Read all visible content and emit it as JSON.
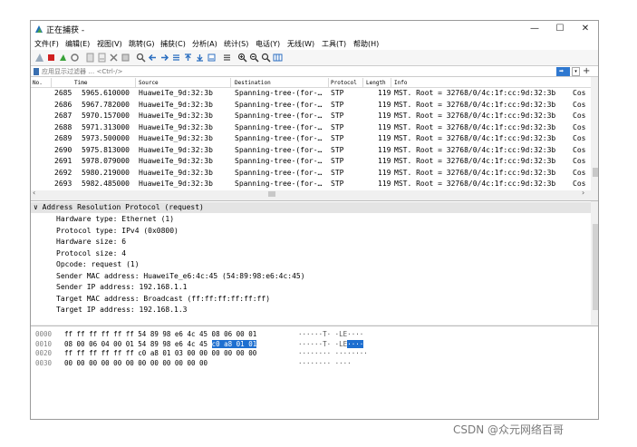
{
  "window": {
    "title": "正在捕获 -",
    "btn_min": "—",
    "btn_max": "☐",
    "btn_close": "✕"
  },
  "menu": [
    "文件(F)",
    "编辑(E)",
    "视图(V)",
    "跳转(G)",
    "捕获(C)",
    "分析(A)",
    "统计(S)",
    "电话(Y)",
    "无线(W)",
    "工具(T)",
    "帮助(H)"
  ],
  "filter": {
    "placeholder": "应用显示过滤器 … <Ctrl-/>",
    "apply_arrow": "➡",
    "drop": "▾",
    "add": "+"
  },
  "packet_list": {
    "headers": [
      "No.",
      "Time",
      "Source",
      "Destination",
      "Protocol",
      "Length",
      "Info"
    ],
    "rows": [
      [
        "2685",
        "5965.610000",
        "HuaweiTe_9d:32:3b",
        "Spanning-tree-(for-…",
        "STP",
        "119",
        "MST. Root = 32768/0/4c:1f:cc:9d:32:3b",
        "Cos"
      ],
      [
        "2686",
        "5967.782000",
        "HuaweiTe_9d:32:3b",
        "Spanning-tree-(for-…",
        "STP",
        "119",
        "MST. Root = 32768/0/4c:1f:cc:9d:32:3b",
        "Cos"
      ],
      [
        "2687",
        "5970.157000",
        "HuaweiTe_9d:32:3b",
        "Spanning-tree-(for-…",
        "STP",
        "119",
        "MST. Root = 32768/0/4c:1f:cc:9d:32:3b",
        "Cos"
      ],
      [
        "2688",
        "5971.313000",
        "HuaweiTe_9d:32:3b",
        "Spanning-tree-(for-…",
        "STP",
        "119",
        "MST. Root = 32768/0/4c:1f:cc:9d:32:3b",
        "Cos"
      ],
      [
        "2689",
        "5973.500000",
        "HuaweiTe_9d:32:3b",
        "Spanning-tree-(for-…",
        "STP",
        "119",
        "MST. Root = 32768/0/4c:1f:cc:9d:32:3b",
        "Cos"
      ],
      [
        "2690",
        "5975.813000",
        "HuaweiTe_9d:32:3b",
        "Spanning-tree-(for-…",
        "STP",
        "119",
        "MST. Root = 32768/0/4c:1f:cc:9d:32:3b",
        "Cos"
      ],
      [
        "2691",
        "5978.079000",
        "HuaweiTe_9d:32:3b",
        "Spanning-tree-(for-…",
        "STP",
        "119",
        "MST. Root = 32768/0/4c:1f:cc:9d:32:3b",
        "Cos"
      ],
      [
        "2692",
        "5980.219000",
        "HuaweiTe_9d:32:3b",
        "Spanning-tree-(for-…",
        "STP",
        "119",
        "MST. Root = 32768/0/4c:1f:cc:9d:32:3b",
        "Cos"
      ],
      [
        "2693",
        "5982.485000",
        "HuaweiTe_9d:32:3b",
        "Spanning-tree-(for-…",
        "STP",
        "119",
        "MST. Root = 32768/0/4c:1f:cc:9d:32:3b",
        "Cos"
      ]
    ]
  },
  "details": {
    "header": "∨ Address Resolution Protocol (request)",
    "lines": [
      "Hardware type: Ethernet (1)",
      "Protocol type: IPv4 (0x0800)",
      "Hardware size: 6",
      "Protocol size: 4",
      "Opcode: request (1)",
      "Sender MAC address: HuaweiTe_e6:4c:45 (54:89:98:e6:4c:45)",
      "Sender IP address: 192.168.1.1",
      "Target MAC address: Broadcast (ff:ff:ff:ff:ff:ff)",
      "Target IP address: 192.168.1.3"
    ]
  },
  "bytes": {
    "rows": [
      {
        "offset": "0000",
        "hex": "ff ff ff ff ff ff 54 89  98 e6 4c 45 08 06 00 01",
        "hex_hl": "",
        "hex_tail": "",
        "ascii": "······T· ·LE····",
        "ascii_hl": "",
        "ascii_tail": ""
      },
      {
        "offset": "0010",
        "hex": "08 00 06 04 00 01 54 89  98 e6 4c 45 ",
        "hex_hl": "c0 a8 01 01",
        "hex_tail": "",
        "ascii": "······T· ·LE",
        "ascii_hl": "····",
        "ascii_tail": ""
      },
      {
        "offset": "0020",
        "hex": "ff ff ff ff ff ff c0 a8  01 03 00 00 00 00 00 00",
        "hex_hl": "",
        "hex_tail": "",
        "ascii": "········ ········",
        "ascii_hl": "",
        "ascii_tail": ""
      },
      {
        "offset": "0030",
        "hex": "00 00 00 00 00 00 00 00  00 00 00 00",
        "hex_hl": "",
        "hex_tail": "",
        "ascii": "········ ····",
        "ascii_hl": "",
        "ascii_tail": ""
      }
    ]
  },
  "watermark": "CSDN @众元网络百哥",
  "colors": {
    "accent": "#1e6fd0",
    "selected_row": "#e4e4e4"
  },
  "toolbar_icons": [
    "shark-fin-icon",
    "stop-icon",
    "restart-icon",
    "options-icon",
    "open-icon",
    "save-icon",
    "close-file-icon",
    "reload-icon",
    "find-icon",
    "back-icon",
    "forward-icon",
    "goto-icon",
    "first-icon",
    "last-icon",
    "autoscroll-icon",
    "colorize-icon",
    "zoom-in-icon",
    "zoom-out-icon",
    "zoom-reset-icon",
    "resize-columns-icon"
  ]
}
